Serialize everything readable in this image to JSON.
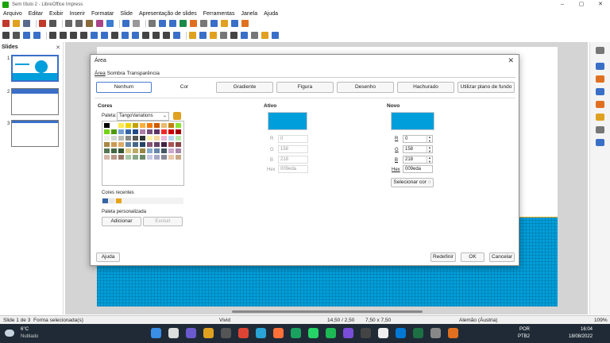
{
  "window": {
    "title": "Sem título 2 - LibreOffice Impress",
    "controls": [
      "–",
      "▢",
      "✕"
    ]
  },
  "menu": [
    "Arquivo",
    "Editar",
    "Exibir",
    "Inserir",
    "Formatar",
    "Slide",
    "Apresentação de slides",
    "Ferramentas",
    "Janela",
    "Ajuda"
  ],
  "slides_pane": {
    "header": "Slides",
    "close": "✕",
    "numbers": [
      "1",
      "2",
      "3"
    ]
  },
  "dialog": {
    "title": "Área",
    "close": "✕",
    "tabs": [
      "Área",
      "Sombra",
      "Transparência"
    ],
    "fill_buttons": [
      "Nenhum",
      "Cor",
      "Gradiente",
      "Figura",
      "Desenho",
      "Hachurado",
      "Utilizar plano de fundo"
    ],
    "cores": {
      "heading": "Cores",
      "palette_label": "Paleta:",
      "palette_value": "TangoVariations",
      "recent_label": "Cores recentes",
      "custom_label": "Paleta personalizada",
      "add_button": "Adicionar",
      "delete_button": "Excluir"
    },
    "ativo": {
      "heading": "Ativo",
      "color": "#009eda",
      "r_label": "R",
      "r": "0",
      "g_label": "G",
      "g": "158",
      "b_label": "B",
      "b": "218",
      "hex_label": "Hex",
      "hex": "009eda"
    },
    "novo": {
      "heading": "Novo",
      "color": "#009eda",
      "r_label": "R",
      "r": "0",
      "g_label": "G",
      "g": "158",
      "b_label": "B",
      "b": "218",
      "hex_label": "Hex",
      "hex": "009eda",
      "pick_button": "Selecionar cor"
    },
    "help_button": "Ajuda",
    "reset_button": "Redefinir",
    "ok_button": "OK",
    "cancel_button": "Cancelar"
  },
  "recent_colors": [
    "#3465a4",
    "#e8e8e8",
    "#e8a317"
  ],
  "statusbar": {
    "slide": "Slide 1 de 3",
    "selection": "Forma selecionada(s)",
    "theme": "Vivid",
    "position": "14,50 / 2,50",
    "size": "7,50 x 7,50",
    "language": "Alemão (Áustria)",
    "zoom": "109%"
  },
  "taskbar": {
    "weather_temp": "6°C",
    "weather_desc": "Nublado",
    "lang1": "POR",
    "lang2": "PTB2",
    "time": "16:04",
    "date": "18/08/2022"
  }
}
